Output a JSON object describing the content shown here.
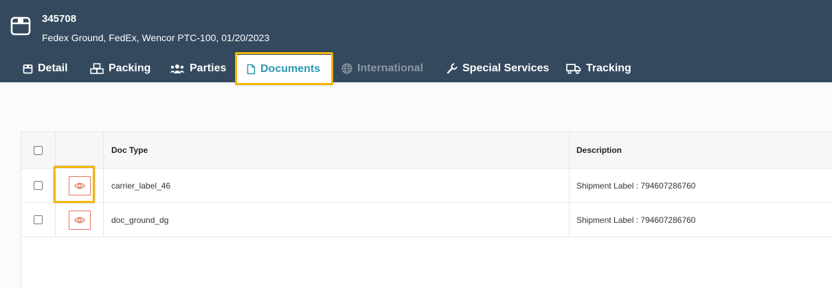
{
  "header": {
    "shipment_id": "345708",
    "subtitle": "Fedex Ground, FedEx, Wencor PTC-100, 01/20/2023",
    "icon": "package-box-icon"
  },
  "tabs": [
    {
      "label": "Detail",
      "icon": "calendar-box-icon",
      "state": "normal"
    },
    {
      "label": "Packing",
      "icon": "boxes-icon",
      "state": "normal"
    },
    {
      "label": "Parties",
      "icon": "users-icon",
      "state": "normal"
    },
    {
      "label": "Documents",
      "icon": "file-icon",
      "state": "active"
    },
    {
      "label": "International",
      "icon": "globe-icon",
      "state": "disabled"
    },
    {
      "label": "Special Services",
      "icon": "wrench-icon",
      "state": "normal"
    },
    {
      "label": "Tracking",
      "icon": "truck-icon",
      "state": "normal"
    }
  ],
  "table": {
    "columns": [
      "",
      "",
      "Doc Type",
      "Description"
    ],
    "rows": [
      {
        "doc_type": "carrier_label_46",
        "description": "Shipment Label : 794607286760"
      },
      {
        "doc_type": "doc_ground_dg",
        "description": "Shipment Label : 794607286760"
      }
    ]
  },
  "colors": {
    "header_bg": "#34495e",
    "active_tab_text": "#2b97b3",
    "highlight": "#f2b705",
    "view_button": "#e0745a"
  }
}
